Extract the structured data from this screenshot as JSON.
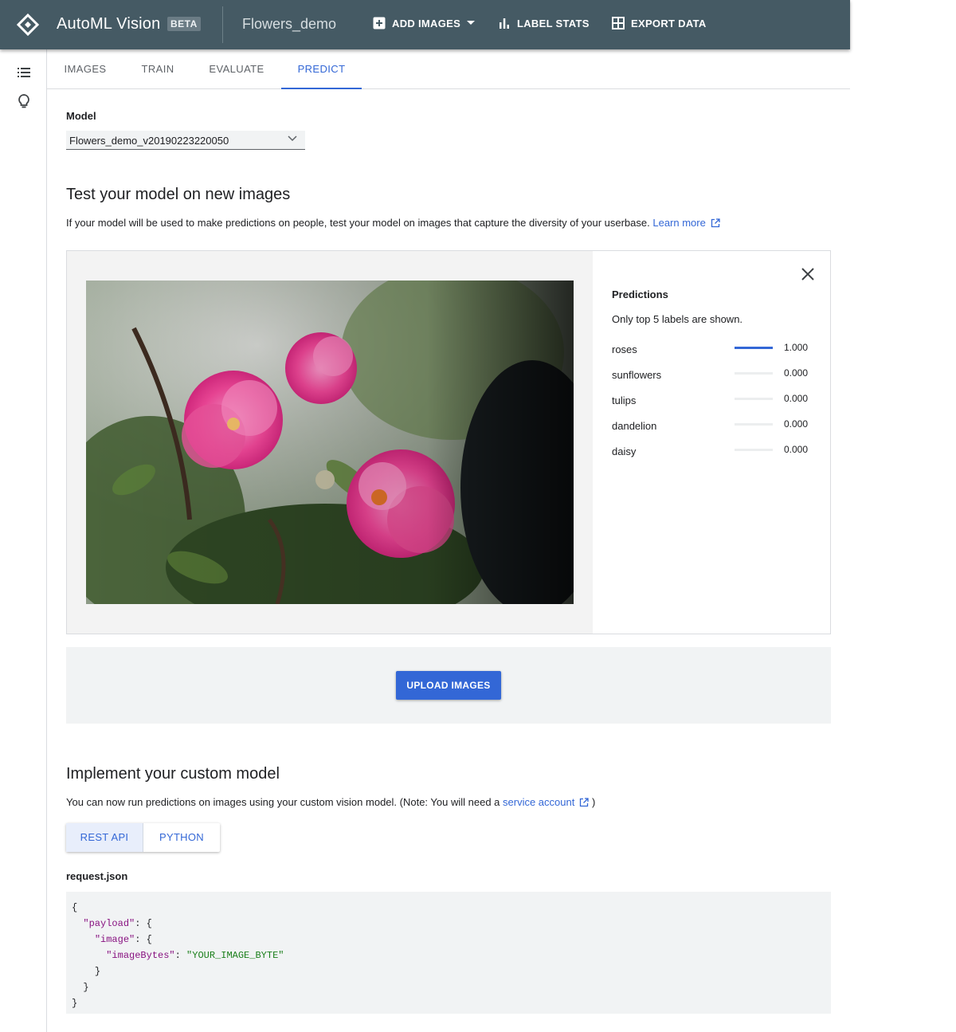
{
  "app": {
    "product_name": "AutoML Vision",
    "badge": "BETA",
    "dataset_name": "Flowers_demo",
    "toolbar": {
      "add_images": "ADD IMAGES",
      "label_stats": "LABEL STATS",
      "export_data": "EXPORT DATA"
    }
  },
  "rail": {
    "icons": [
      "list-icon",
      "lightbulb-icon"
    ]
  },
  "tabs": [
    {
      "label": "IMAGES",
      "active": false
    },
    {
      "label": "TRAIN",
      "active": false
    },
    {
      "label": "EVALUATE",
      "active": false
    },
    {
      "label": "PREDICT",
      "active": true
    }
  ],
  "model": {
    "label": "Model",
    "selected": "Flowers_demo_v20190223220050"
  },
  "test": {
    "heading": "Test your model on new images",
    "description": "If your model will be used to make predictions on people, test your model on images that capture the diversity of your userbase.",
    "learn_more": "Learn more"
  },
  "predictions": {
    "title": "Predictions",
    "note": "Only top 5 labels are shown.",
    "items": [
      {
        "label": "roses",
        "score": "1.000",
        "value": 1.0
      },
      {
        "label": "sunflowers",
        "score": "0.000",
        "value": 0.0
      },
      {
        "label": "tulips",
        "score": "0.000",
        "value": 0.0
      },
      {
        "label": "dandelion",
        "score": "0.000",
        "value": 0.0
      },
      {
        "label": "daisy",
        "score": "0.000",
        "value": 0.0
      }
    ]
  },
  "upload": {
    "button": "UPLOAD IMAGES"
  },
  "implement": {
    "heading": "Implement your custom model",
    "description": "You can now run predictions on images using your custom vision model. (Note: You will need a",
    "service_account": "service account",
    "closing": ")",
    "toggles": [
      "REST API",
      "PYTHON"
    ],
    "file_label": "request.json",
    "code": {
      "open": "{",
      "payload_key": "\"payload\"",
      "image_key": "\"image\"",
      "bytes_key": "\"imageBytes\"",
      "bytes_value": "\"YOUR_IMAGE_BYTE\"",
      "colon_brace": ": {",
      "colon": ": ",
      "close": "}"
    }
  },
  "colors": {
    "appbar": "#455a64",
    "accent": "#3367d6"
  }
}
